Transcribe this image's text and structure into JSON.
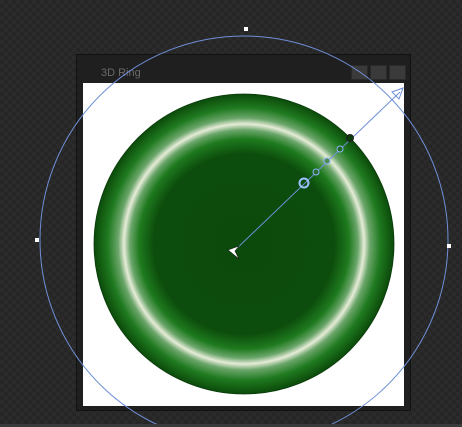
{
  "panel": {
    "title": "3D Ring",
    "controls": [
      "minimize-control",
      "maximize-control",
      "close-control"
    ]
  },
  "colors": {
    "ring_dark": "#0b4a0b",
    "ring_mid": "#1f7a1f",
    "ring_highlight": "#e6ecd8",
    "guide": "#6f8fd8",
    "handle_fill": "#ffffff",
    "content_bg": "#ffffff",
    "panel_bg": "#1f1f1f",
    "workspace_bg": "#2b2b2b"
  },
  "icons": {
    "center_pointer": "arrow-pointer-icon",
    "direction_arrow": "arrow-head-icon"
  }
}
